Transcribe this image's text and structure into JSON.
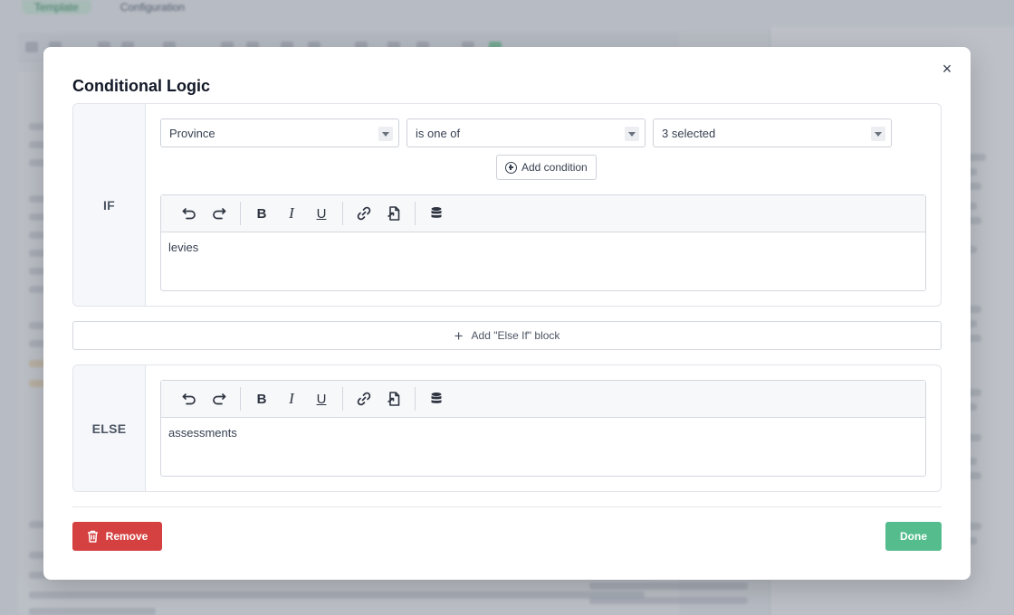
{
  "background": {
    "tabs": [
      "Template",
      "Configuration"
    ]
  },
  "modal": {
    "title": "Conditional Logic",
    "close_icon": "×",
    "if_block": {
      "label": "IF",
      "conditions": [
        {
          "field": "Province",
          "operator": "is one of",
          "value": "3 selected"
        }
      ],
      "add_condition_label": "Add condition",
      "content": "levies"
    },
    "add_else_if_label": "Add \"Else If\" block",
    "else_block": {
      "label": "ELSE",
      "content": "assessments"
    },
    "toolbar": {
      "bold": "B",
      "italic": "I",
      "underline": "U"
    },
    "remove_label": "Remove",
    "done_label": "Done",
    "colors": {
      "remove": "#d54141",
      "done": "#55bd8d"
    }
  }
}
